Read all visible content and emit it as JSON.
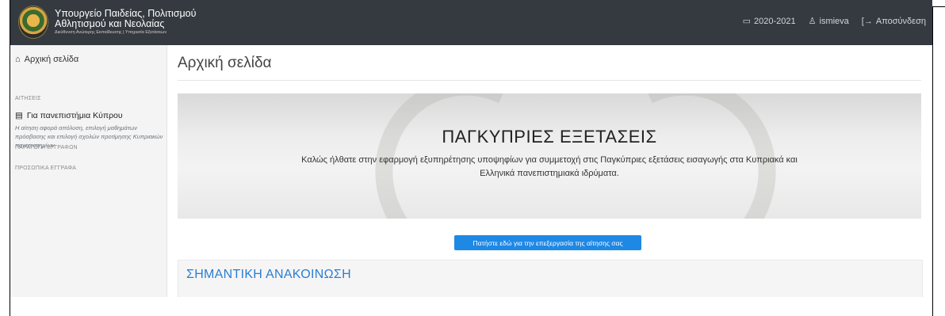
{
  "header": {
    "brand_line1": "Υπουργείο Παιδείας, Πολιτισμού",
    "brand_line2": "Αθλητισμού και Νεολαίας",
    "brand_line3": "Διεύθυνση Ανώτερης Εκπαίδευσης | Υπηρεσία Εξετάσεων",
    "year": "2020-2021",
    "user": "ismieva",
    "logout": "Αποσύνδεση"
  },
  "sidebar": {
    "home": "Αρχική σελίδα",
    "section_applications": "ΑΙΤΗΣΕΙΣ",
    "cyprus_link": "Για πανεπιστήμια Κύπρου",
    "cyprus_desc": "Η αίτηση αφορά απόλυση, επιλογή μαθημάτων πρόσβασης και επιλογή σχολών προτίμησης Κυπριακών πανεπιστημίων",
    "section_documents": "ΠΑΡΑΓΩΓΗ ΕΓΓΡΑΦΩΝ",
    "section_personal": "ΠΡΟΣΩΠΙΚΑ ΕΓΓΡΑΦΑ"
  },
  "main": {
    "title": "Αρχική σελίδα",
    "hero_title": "ΠΑΓΚΥΠΡΙΕΣ ΕΞΕΤΑΣΕΙΣ",
    "hero_text": "Καλώς ήλθατε στην εφαρμογή εξυπηρέτησης υποψηφίων για συμμετοχή στις Παγκύπριες εξετάσεις εισαγωγής στα Κυπριακά και Ελληνικά πανεπιστημιακά ιδρύματα.",
    "action_button": "Πατήστε εδώ για την επεξεργασία της αίτησης σας",
    "notice_title": "ΣΗΜΑΝΤΙΚΗ ΑΝΑΚΟΙΝΩΣΗ"
  },
  "colors": {
    "navbar": "#343a40",
    "primary": "#1e88e5",
    "notice_title": "#2a7ed3"
  }
}
